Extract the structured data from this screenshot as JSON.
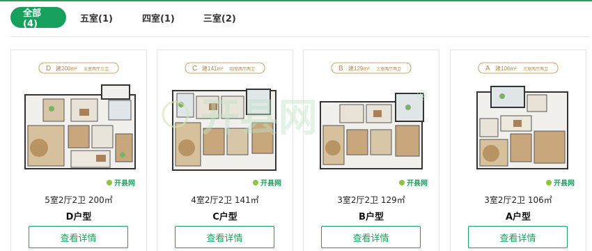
{
  "tabs": [
    {
      "label": "全部(4)",
      "active": true
    },
    {
      "label": "五室(1)",
      "active": false
    },
    {
      "label": "四室(1)",
      "active": false
    },
    {
      "label": "三室(2)",
      "active": false
    }
  ],
  "cards": [
    {
      "badge_letter": "D",
      "badge_area": "建200m²",
      "badge_desc": "五室两厅三卫",
      "spec": "5室2厅2卫 200㎡",
      "type": "D户型",
      "button": "查看详情",
      "logo": "开县网"
    },
    {
      "badge_letter": "C",
      "badge_area": "建141m²",
      "badge_desc": "四室两厅两卫",
      "spec": "4室2厅2卫 141㎡",
      "type": "C户型",
      "button": "查看详情",
      "logo": "开县网"
    },
    {
      "badge_letter": "B",
      "badge_area": "建129m²",
      "badge_desc": "三室两厅两卫",
      "spec": "3室2厅2卫 129㎡",
      "type": "B户型",
      "button": "查看详情",
      "logo": "开县网"
    },
    {
      "badge_letter": "A",
      "badge_area": "建106m²",
      "badge_desc": "三室两厅两卫",
      "spec": "3室2厅2卫 106㎡",
      "type": "A户型",
      "button": "查看详情",
      "logo": "开县网"
    }
  ],
  "watermark": {
    "text": "开县网",
    "mark": "®"
  },
  "colors": {
    "accent": "#17a05d",
    "badge": "#c8a46a",
    "wall": "#333333",
    "wood": "#c9a77c",
    "grass": "#7fb069"
  }
}
